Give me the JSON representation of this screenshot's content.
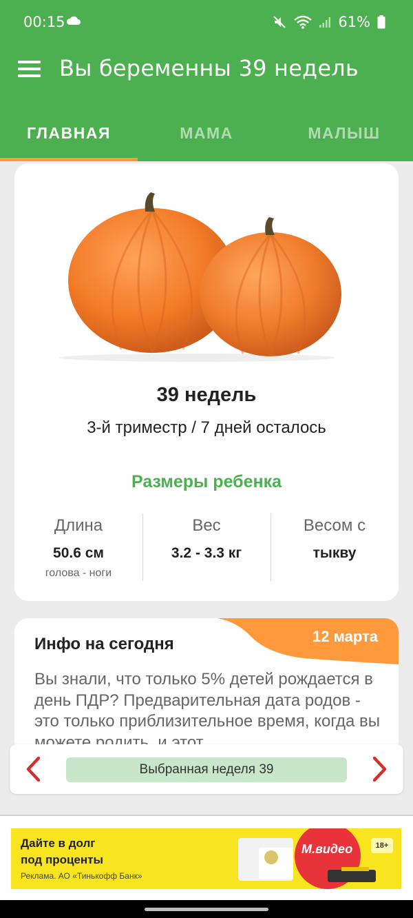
{
  "status_bar": {
    "time": "00:15",
    "battery": "61%",
    "cloud_icon": "cloud-icon",
    "mute_icon": "mute-icon",
    "wifi_icon": "wifi-icon",
    "signal_icon": "signal-icon",
    "battery_icon": "battery-icon"
  },
  "app_bar": {
    "title": "Вы беременны 39 недель",
    "menu_icon": "hamburger-menu-icon"
  },
  "tabs": [
    {
      "label": "ГЛАВНАЯ",
      "active": true
    },
    {
      "label": "МАМА",
      "active": false
    },
    {
      "label": "МАЛЫШ",
      "active": false
    }
  ],
  "week_card": {
    "image": "pumpkins-image",
    "weeks": "39 недель",
    "trimester": "3-й триместр / 7 дней осталось",
    "sizes_title": "Размеры ребенка",
    "stats": [
      {
        "label": "Длина",
        "value": "50.6 см",
        "sub": "голова - ноги"
      },
      {
        "label": "Вес",
        "value": "3.2 - 3.3 кг",
        "sub": ""
      },
      {
        "label": "Весом с",
        "value": "тыкву",
        "sub": ""
      }
    ]
  },
  "info_card": {
    "title": "Инфо на сегодня",
    "date": "12 марта",
    "text": "Вы знали, что только 5% детей рождается в день ПДР? Предварительная дата родов - это только приблизительное время, когда вы можете родить, и этот"
  },
  "week_nav": {
    "label": "Выбранная неделя 39",
    "prev_icon": "chevron-left-icon",
    "next_icon": "chevron-right-icon"
  },
  "ad": {
    "line1": "Дайте в долг",
    "line2": "под проценты",
    "legal": "Реклама. АО «Тинькофф Банк»",
    "age": "18+",
    "brand": "М.видео"
  },
  "colors": {
    "primary": "#4caf50",
    "accent": "#ff9a3c",
    "nav_arrow": "#d32f2f",
    "pill": "#c8e6c9",
    "ad_bg": "#f8e41f"
  }
}
